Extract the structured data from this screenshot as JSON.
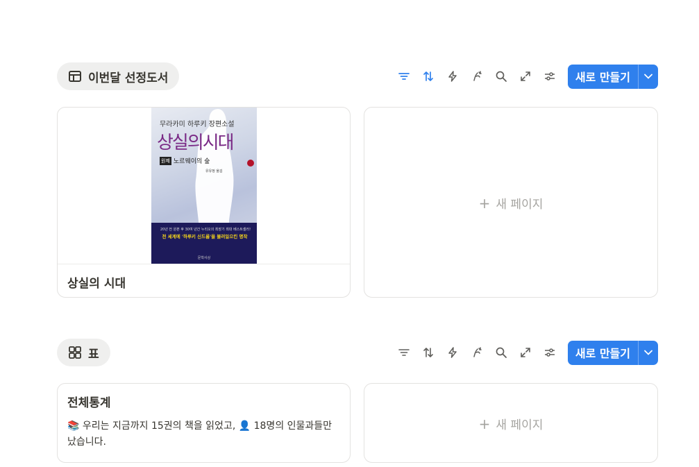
{
  "sections": [
    {
      "view_name": "이번달 선정도서",
      "view_icon": "table-layout-icon",
      "new_button_label": "새로 만들기",
      "accent": "#2f80ed",
      "toolbar_icons": [
        "filter-icon",
        "sort-icon",
        "lightning-icon",
        "ai-pen-icon",
        "search-icon",
        "expand-icon",
        "settings-icon"
      ],
      "cards": [
        {
          "title": "상실의 시대",
          "cover": {
            "author_line": "무라카미 하루키 장편소설",
            "big_title": "상실의시대",
            "badge": "원제",
            "subtitle": "노르웨이의 숲",
            "translator": "유유정 옮김",
            "tagline": "20년 전 원본 후 30여 년간 누리오의 최장기 최대 베스트셀러!",
            "headline": "전 세계에 '하루키 신드롬'을 불러일으킨 명작",
            "publisher": "문학사상"
          }
        }
      ],
      "new_page_label": "새 페이지"
    },
    {
      "view_name": "표",
      "view_icon": "gallery-grid-icon",
      "new_button_label": "새로 만들기",
      "toolbar_icons": [
        "filter-icon",
        "sort-icon",
        "lightning-icon",
        "ai-pen-icon",
        "search-icon",
        "expand-icon",
        "settings-icon"
      ],
      "cards": [
        {
          "title": "전체통계",
          "desc_books_emoji": "📚",
          "desc_text_1": " 우리는 지금까지 15권의 책을 읽었고, ",
          "desc_person_emoji": "👤",
          "desc_text_2": " 18명의 인물과들만났습니다."
        }
      ],
      "new_page_label": "새 페이지"
    }
  ]
}
